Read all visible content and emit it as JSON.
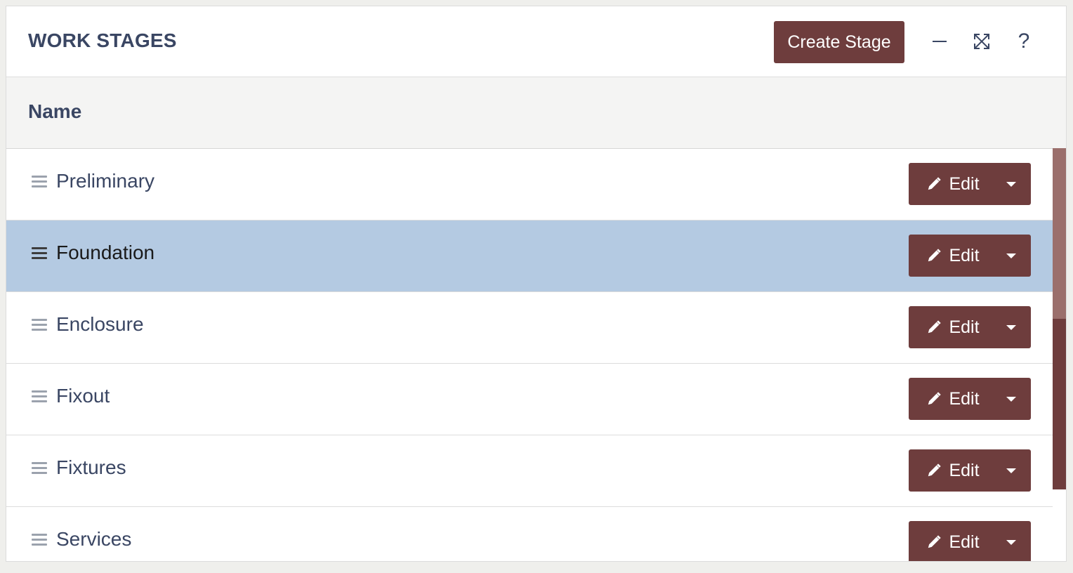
{
  "panel": {
    "title": "WORK STAGES",
    "create_label": "Create Stage",
    "icons": {
      "minimize": "minimize-icon",
      "expand": "expand-icon",
      "help": "help-icon",
      "help_glyph": "?"
    }
  },
  "table": {
    "column_header": "Name",
    "edit_label": "Edit",
    "rows": [
      {
        "label": "Preliminary",
        "selected": false
      },
      {
        "label": "Foundation",
        "selected": true
      },
      {
        "label": "Enclosure",
        "selected": false
      },
      {
        "label": "Fixout",
        "selected": false
      },
      {
        "label": "Fixtures",
        "selected": false
      },
      {
        "label": "Services",
        "selected": false
      }
    ]
  },
  "colors": {
    "accent": "#6e3d3d",
    "selected_row": "#b4cae2",
    "heading_text": "#3a4663"
  }
}
